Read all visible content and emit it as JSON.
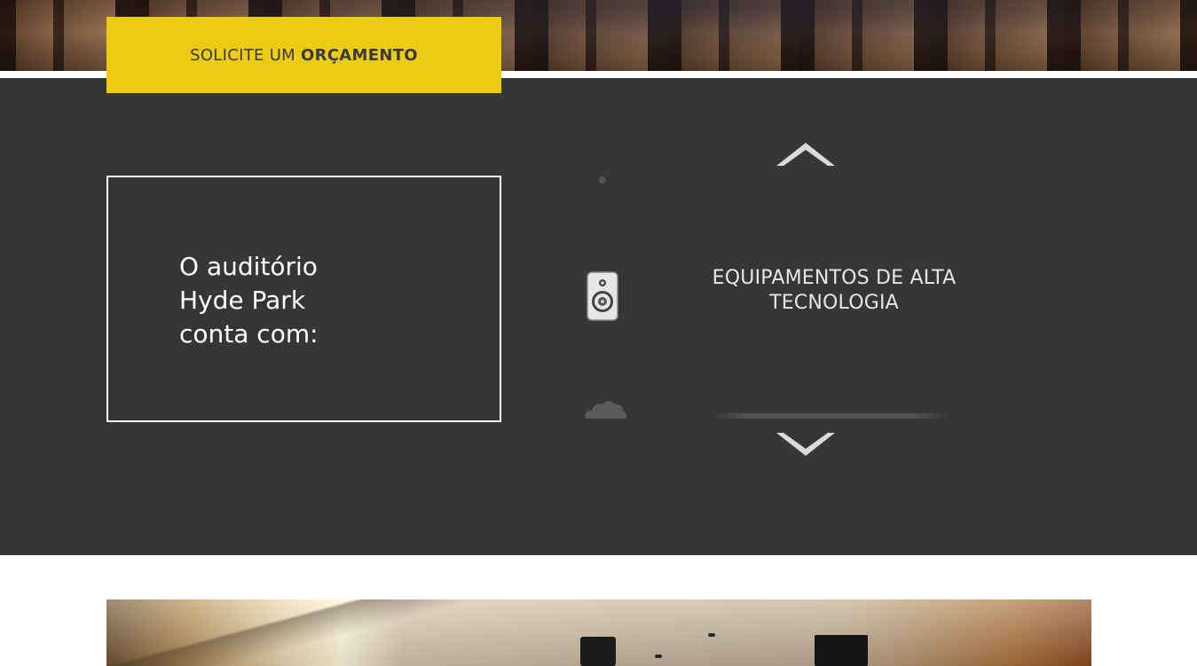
{
  "cta": {
    "label_normal": "SOLICITE UM",
    "label_bold": "ORÇAMENTO",
    "color": "#eccb13"
  },
  "intro": {
    "text": "O auditório Hyde Park conta com:"
  },
  "features": {
    "current": {
      "icon": "speaker-icon",
      "label": "EQUIPAMENTOS DE ALTA TECNOLOGIA"
    },
    "next_icon": "cloud-icon"
  },
  "colors": {
    "dark_bg": "#363636",
    "text": "#e6e6e6",
    "accent": "#eccb13"
  }
}
